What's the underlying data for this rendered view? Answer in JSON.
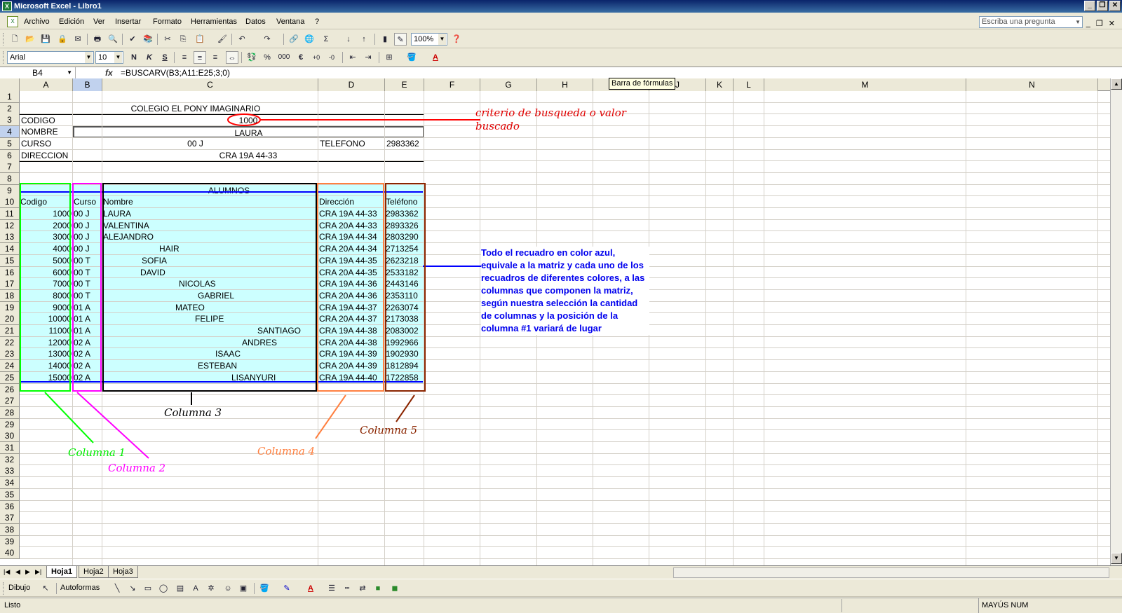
{
  "window": {
    "title": "Microsoft Excel - Libro1"
  },
  "menu": {
    "items": [
      "Archivo",
      "Edición",
      "Ver",
      "Insertar",
      "Formato",
      "Herramientas",
      "Datos",
      "Ventana",
      "?"
    ],
    "ask_placeholder": "Escriba una pregunta"
  },
  "toolbar": {
    "zoom": "100%",
    "font": "Arial",
    "size": "10",
    "bold": "N",
    "italic": "K",
    "underline": "S",
    "percent": "%",
    "thousands": "000",
    "euro": "€"
  },
  "formula_bar": {
    "cell_ref": "B4",
    "fx": "fx",
    "formula": "=BUSCARV(B3;A11:E25;3;0)",
    "tooltip": "Barra de fórmulas"
  },
  "columns": [
    "A",
    "B",
    "C",
    "D",
    "E",
    "F",
    "G",
    "H",
    "I",
    "J",
    "K",
    "L",
    "M",
    "N"
  ],
  "rows": [
    "1",
    "2",
    "3",
    "4",
    "5",
    "6",
    "7",
    "8",
    "9",
    "10",
    "11",
    "12",
    "13",
    "14",
    "15",
    "16",
    "17",
    "18",
    "19",
    "20",
    "21",
    "22",
    "23",
    "24",
    "25",
    "26",
    "27",
    "28",
    "29",
    "30",
    "31",
    "32",
    "33",
    "34",
    "35",
    "36",
    "37",
    "38",
    "39",
    "40"
  ],
  "header_form": {
    "school": "COLEGIO EL PONY IMAGINARIO",
    "codigo_label": "CODIGO",
    "codigo_value": "1000",
    "nombre_label": "NOMBRE",
    "nombre_value": "LAURA",
    "curso_label": "CURSO",
    "curso_value": "00 J",
    "telefono_label": "TELEFONO",
    "telefono_value": "2983362",
    "direccion_label": "DIRECCION",
    "direccion_value": "CRA 19A 44-33"
  },
  "table": {
    "title": "ALUMNOS",
    "headers": [
      "Codigo",
      "Curso",
      "Nombre",
      "Dirección",
      "Teléfono"
    ],
    "rows": [
      [
        "1000",
        "00 J",
        "LAURA",
        "CRA 19A 44-33",
        "2983362"
      ],
      [
        "2000",
        "00 J",
        "VALENTINA",
        "CRA 20A 44-33",
        "2893326"
      ],
      [
        "3000",
        "00 J",
        "ALEJANDRO",
        "CRA 19A 44-34",
        "2803290"
      ],
      [
        "4000",
        "00 J",
        "HAIR",
        "CRA 20A 44-34",
        "2713254"
      ],
      [
        "5000",
        "00 T",
        "SOFIA",
        "CRA 19A 44-35",
        "2623218"
      ],
      [
        "6000",
        "00 T",
        "DAVID",
        "CRA 20A 44-35",
        "2533182"
      ],
      [
        "7000",
        "00 T",
        "NICOLAS",
        "CRA 19A 44-36",
        "2443146"
      ],
      [
        "8000",
        "00 T",
        "GABRIEL",
        "CRA 20A 44-36",
        "2353110"
      ],
      [
        "9000",
        "01 A",
        "MATEO",
        "CRA 19A 44-37",
        "2263074"
      ],
      [
        "10000",
        "01 A",
        "FELIPE",
        "CRA 20A 44-37",
        "2173038"
      ],
      [
        "11000",
        "01 A",
        "SANTIAGO",
        "CRA 19A 44-38",
        "2083002"
      ],
      [
        "12000",
        "02 A",
        "ANDRES",
        "CRA 20A 44-38",
        "1992966"
      ],
      [
        "13000",
        "02 A",
        "ISAAC",
        "CRA 19A 44-39",
        "1902930"
      ],
      [
        "14000",
        "02 A",
        "ESTEBAN",
        "CRA 20A 44-39",
        "1812894"
      ],
      [
        "15000",
        "02 A",
        "LISANYURI",
        "CRA 19A 44-40",
        "1722858"
      ]
    ]
  },
  "annotations": {
    "criterio": "criterio de busqueda o valor buscado",
    "note": "Todo el recuadro en color azul, equivale a la matriz y cada uno de los recuadros de diferentes colores, a las columnas que componen la matriz, según nuestra selección la cantidad de columnas y la posición de la columna #1 variará de lugar",
    "col1": "Columna 1",
    "col2": "Columna 2",
    "col3": "Columna 3",
    "col4": "Columna 4",
    "col5": "Columna 5",
    "colors": {
      "red": "#ff0000",
      "blue": "#0000ff",
      "green": "#00ff00",
      "magenta": "#ff00ff",
      "black": "#000000",
      "orange": "#ff8040",
      "brown": "#8b2500"
    }
  },
  "sheets": [
    "Hoja1",
    "Hoja2",
    "Hoja3"
  ],
  "drawing": {
    "draw": "Dibujo",
    "autoshapes": "Autoformas"
  },
  "status": {
    "text": "Listo",
    "mode": "MAYÚS NUM"
  }
}
